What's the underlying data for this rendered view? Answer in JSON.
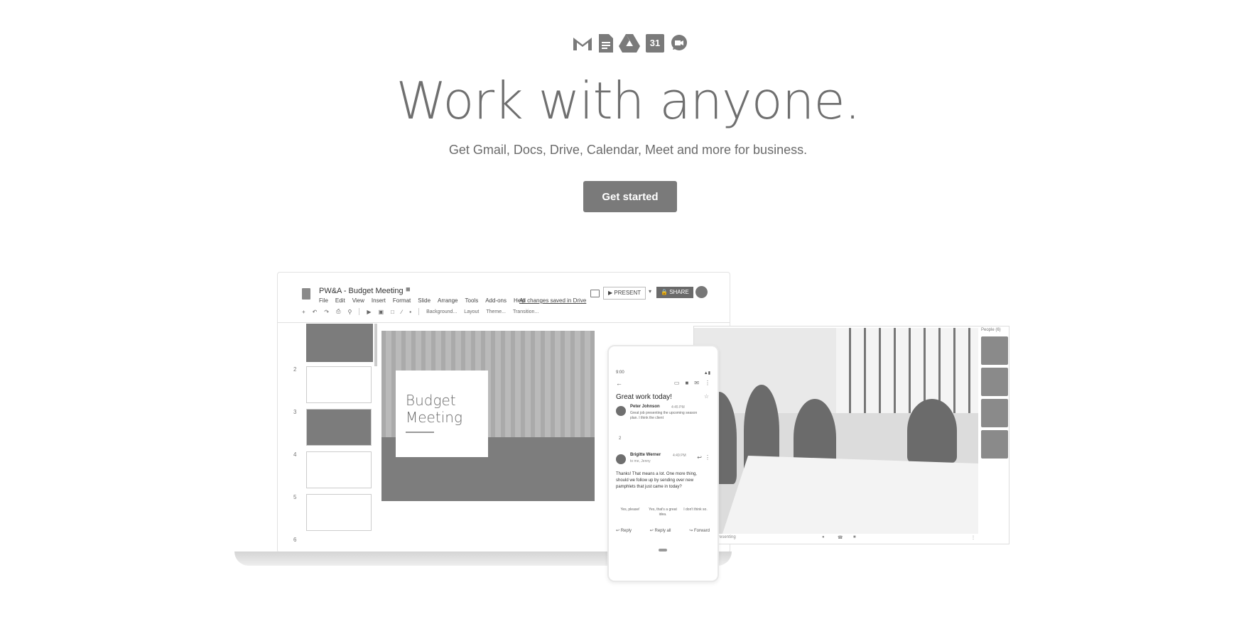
{
  "hero": {
    "app_icons": [
      "gmail-icon",
      "docs-icon",
      "drive-icon",
      "calendar-icon",
      "meet-icon"
    ],
    "calendar_day": "31",
    "headline": "Work with anyone.",
    "subheadline": "Get Gmail, Docs, Drive, Calendar, Meet and more for business.",
    "cta_label": "Get started",
    "accent_color": "#7a7a7a"
  },
  "slides": {
    "doc_title": "PW&A - Budget Meeting",
    "menu": [
      "File",
      "Edit",
      "View",
      "Insert",
      "Format",
      "Slide",
      "Arrange",
      "Tools",
      "Add-ons",
      "Help"
    ],
    "saved_status": "All changes saved in Drive",
    "present_label": "PRESENT",
    "share_label": "SHARE",
    "toolbar_labels": [
      "Background...",
      "Layout",
      "Theme...",
      "Transition..."
    ],
    "thumbnail_numbers": [
      "2",
      "3",
      "4",
      "5",
      "6"
    ],
    "slide_title_line1": "Budget",
    "slide_title_line2": "Meeting"
  },
  "phone": {
    "time": "9:00",
    "subject": "Great work today!",
    "messages": [
      {
        "sender": "Peter Johnson",
        "meta": "4:45 PM",
        "snippet": "Great job presenting the upcoming season plan. I think the client"
      },
      {
        "sender": "Brigitte Werner",
        "meta": "4:49 PM",
        "to": "to me, Jenny"
      }
    ],
    "count": "2",
    "body": "Thanks! That means a lot. One more thing, should we follow up by sending over new pamphlets that just came in today?",
    "smart_replies": [
      "Yes, please!",
      "Yes, that's a great idea.",
      "I don't think so."
    ],
    "actions": [
      "Reply",
      "Reply all",
      "Forward"
    ]
  },
  "meet": {
    "label": "People (6)",
    "footer_left": "Presenting"
  }
}
